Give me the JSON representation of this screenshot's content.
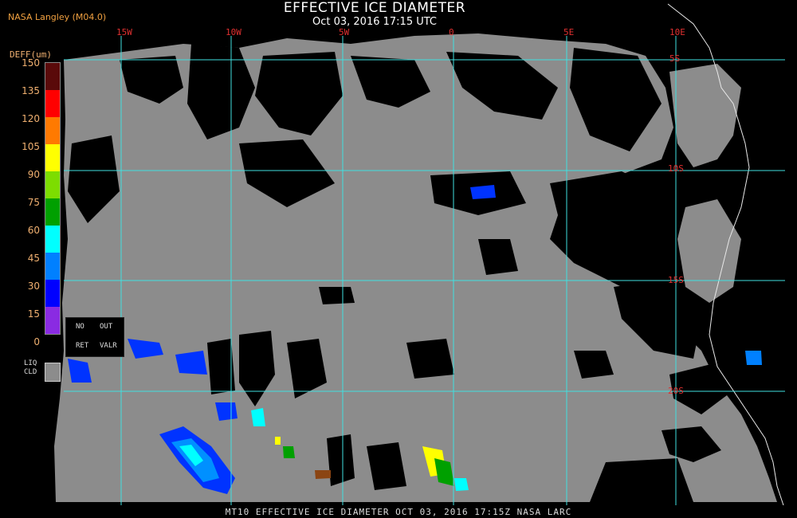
{
  "header": {
    "title": "EFFECTIVE ICE DIAMETER",
    "subtitle": "Oct 03, 2016 17:15 UTC",
    "agency": "NASA Langley (M04.0)"
  },
  "grid": {
    "lon_labels": [
      "15W",
      "10W",
      "5W",
      "0",
      "5E",
      "10E"
    ],
    "lat_labels": [
      "5S",
      "10S",
      "15S",
      "20S"
    ]
  },
  "legend": {
    "unit": "DEFF(um)",
    "ticks": [
      "150",
      "135",
      "120",
      "105",
      "90",
      "75",
      "60",
      "45",
      "30",
      "15",
      "0"
    ],
    "colors": [
      "#5a0a0a",
      "#ff0000",
      "#ff7a00",
      "#ffff00",
      "#7ddd00",
      "#00a000",
      "#00ffff",
      "#0080ff",
      "#0000ff",
      "#8a2be2"
    ],
    "box": {
      "no": "NO",
      "out": "OUT",
      "ret": "RET",
      "valr": "VALR"
    },
    "liq_top": "LIQ",
    "liq_bottom": "CLD",
    "liq_color": "#8c8c8c"
  },
  "footer": "MT10  EFFECTIVE ICE DIAMETER   OCT 03, 2016 17:15Z   NASA LARC"
}
